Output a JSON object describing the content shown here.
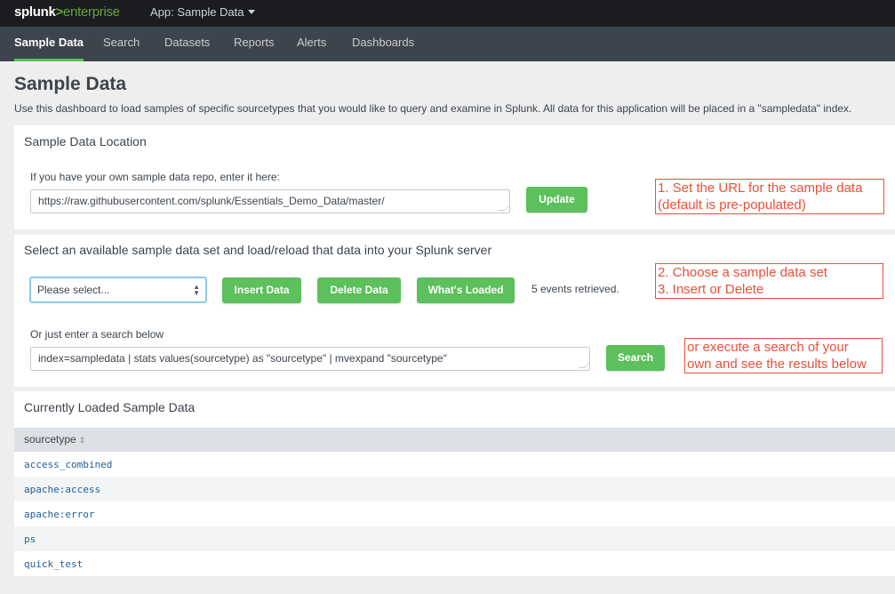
{
  "topbar": {
    "logo_main": "splunk",
    "logo_gt": ">",
    "logo_suffix": "enterprise",
    "app_menu": "App: Sample Data"
  },
  "nav": {
    "items": [
      "Sample Data",
      "Search",
      "Datasets",
      "Reports",
      "Alerts",
      "Dashboards"
    ],
    "active": "Sample Data"
  },
  "page": {
    "title": "Sample Data",
    "description": "Use this dashboard to load samples of specific sourcetypes that you would like to query and examine in Splunk. All data for this application will be placed in a \"sampledata\" index."
  },
  "location_panel": {
    "title": "Sample Data Location",
    "label": "If you have your own sample data repo, enter it here:",
    "url_value": "https://raw.githubusercontent.com/splunk/Essentials_Demo_Data/master/",
    "update_button": "Update"
  },
  "load_panel": {
    "title": "Select an available sample data set and load/reload that data into your Splunk server",
    "select_value": "Please select...",
    "insert_button": "Insert Data",
    "delete_button": "Delete Data",
    "loaded_button": "What's Loaded",
    "status": "5 events retrieved.",
    "search_label": "Or just enter a search below",
    "search_value": "index=sampledata | stats values(sourcetype) as \"sourcetype\" | mvexpand \"sourcetype\"",
    "search_button": "Search"
  },
  "annotations": {
    "a1_line1": "1. Set the URL for the sample data",
    "a1_line2": "(default is pre-populated)",
    "a2_line1": "2.  Choose a sample data set",
    "a2_line2": "3.  Insert or Delete",
    "a3_line1": "or execute a search of your",
    "a3_line2": "own and see the results below"
  },
  "results_panel": {
    "title": "Currently Loaded Sample Data",
    "column": "sourcetype",
    "sort_icon": "⇕",
    "rows": [
      "access_combined",
      "apache:access",
      "apache:error",
      "ps",
      "quick_test"
    ]
  },
  "colors": {
    "accent_green": "#5cc05c",
    "annotation_red": "#e8503a",
    "link_blue": "#1e5f97"
  }
}
